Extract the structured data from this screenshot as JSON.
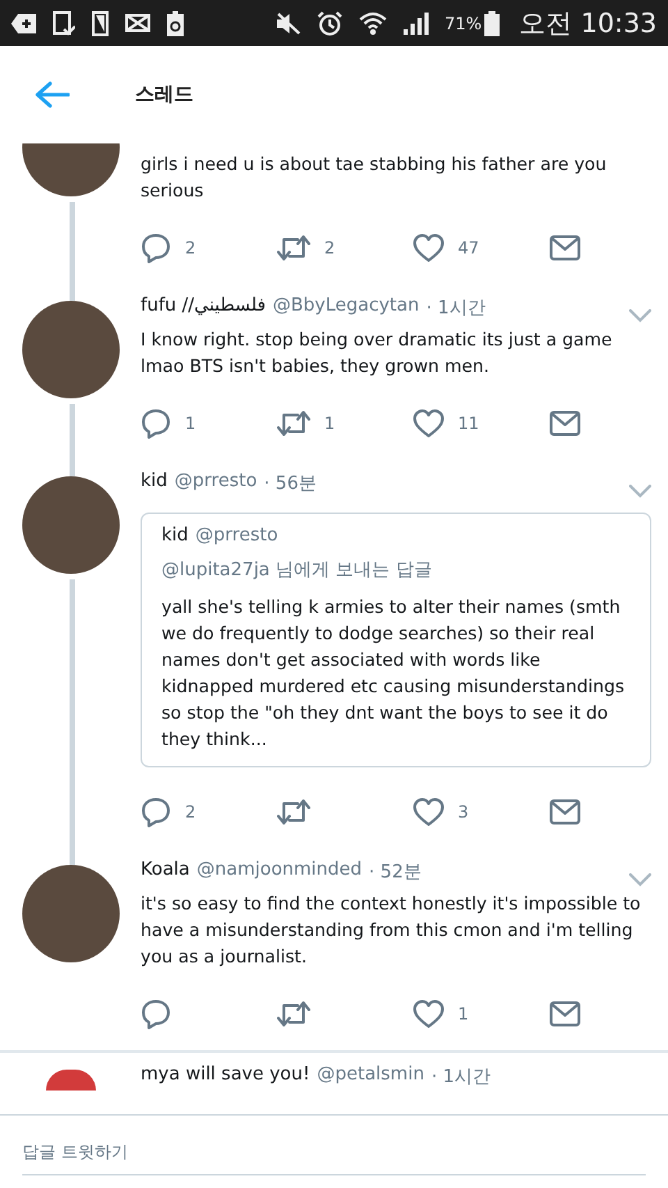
{
  "status_bar": {
    "battery": "71%",
    "time": "오전 10:33"
  },
  "header": {
    "title": "스레드"
  },
  "tweets": [
    {
      "kind": "cut_top",
      "text": "girls i need u is about tae stabbing his father are you serious",
      "replies": "2",
      "retweets": "2",
      "likes": "47",
      "connected_below": true
    },
    {
      "kind": "full",
      "name": "fufu //فلسطيني",
      "handle": "@BbyLegacytan",
      "time": "· 1시간",
      "text": "I know right. stop being over dramatic its just a game lmao BTS isn't babies, they grown men.",
      "replies": "1",
      "retweets": "1",
      "likes": "11",
      "connected_below": true
    },
    {
      "kind": "full",
      "name": "kid",
      "handle": "@prresto",
      "time": "· 56분",
      "quote": {
        "name": "kid",
        "handle": "@prresto",
        "reply_to": "@lupita27ja 님에게 보내는 답글",
        "text": "yall she's telling k armies to alter their names (smth we do frequently to dodge searches) so their real names don't get associated with words like kidnapped murdered etc causing misunderstandings so stop the \"oh they dnt want the boys to see it do they think..."
      },
      "replies": "2",
      "likes": "3",
      "connected_below": true
    },
    {
      "kind": "full",
      "name": "Koala",
      "handle": "@namjoonminded",
      "time": "· 52분",
      "text": "it's so easy to find the context honestly it's impossible to have a misunderstanding from this cmon and i'm telling you as a journalist.",
      "likes": "1",
      "connected_below": false
    },
    {
      "kind": "cut_bottom",
      "name": "mya will save you!",
      "handle": "@petalsmin",
      "time": "· 1시간",
      "connected_below": false
    }
  ],
  "reply_bar": {
    "placeholder": "답글 트윗하기"
  }
}
